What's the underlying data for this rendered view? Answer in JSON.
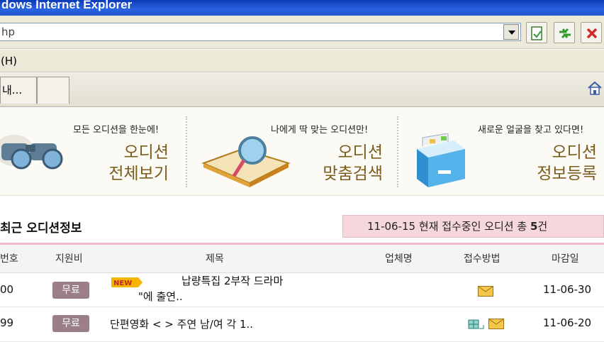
{
  "browser": {
    "title": "dows Internet Explorer",
    "address": "hp",
    "menu_item": "(H)",
    "tabs": [
      {
        "label": "내..."
      },
      {
        "label": ""
      }
    ]
  },
  "banner": {
    "cards": [
      {
        "small": "모든 오디션을 한눈에!",
        "big_line1": "오디션",
        "big_line2": "전체보기",
        "icon": "binoculars-icon"
      },
      {
        "small": "나에게 딱 맞는 오디션만!",
        "big_line1": "오디션",
        "big_line2": "맞춤검색",
        "icon": "magnifier-book-icon"
      },
      {
        "small": "새로운 얼굴을 찾고 있다면!",
        "big_line1": "오디션",
        "big_line2": "정보등록",
        "icon": "file-cabinet-icon"
      }
    ]
  },
  "section": {
    "title": "최근 오디션정보",
    "status_prefix": "11-06-15 현재 접수중인 오디션 총 ",
    "status_count": "5",
    "status_suffix": "건"
  },
  "table": {
    "headers": [
      "번호",
      "지원비",
      "제목",
      "업체명",
      "접수방법",
      "마감일"
    ],
    "rows": [
      {
        "no": "00",
        "fee": "무료",
        "is_new": true,
        "new_label": "NEW",
        "title_line1": "납량특집 2부작 드라마",
        "title_line2": "\"에 출연..",
        "company": "",
        "methods": [
          "mail"
        ],
        "deadline": "11-06-30"
      },
      {
        "no": "99",
        "fee": "무료",
        "is_new": false,
        "new_label": "",
        "title_line1": "단편영화 <        > 주연 남/여 각 1..",
        "title_line2": "",
        "company": "",
        "methods": [
          "visit",
          "mail"
        ],
        "deadline": "11-06-20"
      }
    ]
  },
  "colors": {
    "accent_pink": "#f5d7dc",
    "badge": "#9a7f86",
    "banner_text": "#7a5c1c"
  }
}
